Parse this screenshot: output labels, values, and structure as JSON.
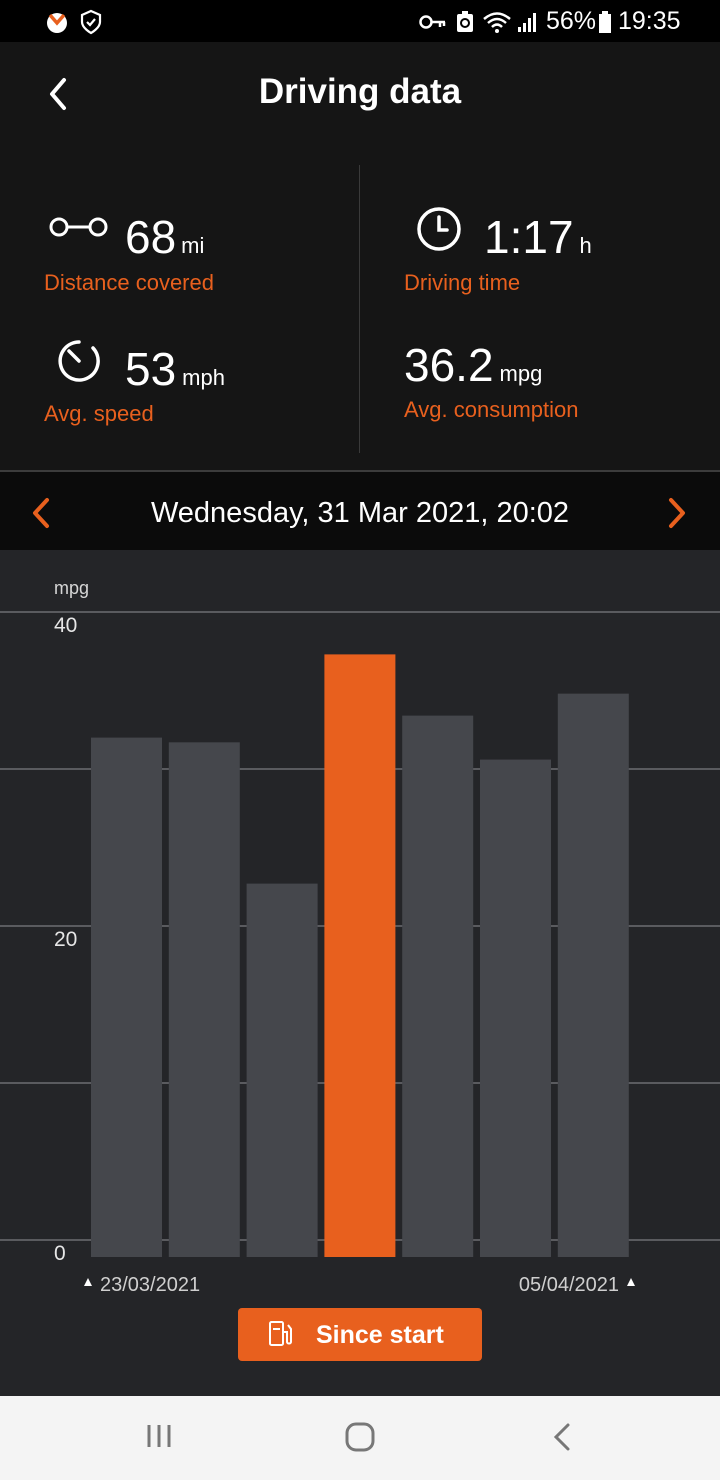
{
  "status_bar": {
    "battery": "56%",
    "time": "19:35"
  },
  "header": {
    "title": "Driving data"
  },
  "stats": {
    "distance": {
      "value": "68",
      "unit": "mi",
      "label": "Distance covered"
    },
    "time": {
      "value": "1:17",
      "unit": "h",
      "label": "Driving time"
    },
    "speed": {
      "value": "53",
      "unit": "mph",
      "label": "Avg. speed"
    },
    "consumption": {
      "value": "36.2",
      "unit": "mpg",
      "label": "Avg. consumption"
    }
  },
  "date_nav": {
    "current": "Wednesday, 31 Mar 2021, 20:02"
  },
  "chart_data": {
    "type": "bar",
    "ylabel": "mpg",
    "ylim": [
      0,
      40
    ],
    "yticks": [
      "0",
      "20",
      "40"
    ],
    "values": [
      32,
      31.7,
      22.7,
      37.3,
      33.4,
      30.6,
      34.8
    ],
    "highlight_index": 3,
    "x_start_label": "23/03/2021",
    "x_end_label": "05/04/2021",
    "bar_color": "#45474c",
    "highlight_color": "#e8601e"
  },
  "button": {
    "label": "Since start"
  },
  "colors": {
    "accent": "#e8601e"
  }
}
